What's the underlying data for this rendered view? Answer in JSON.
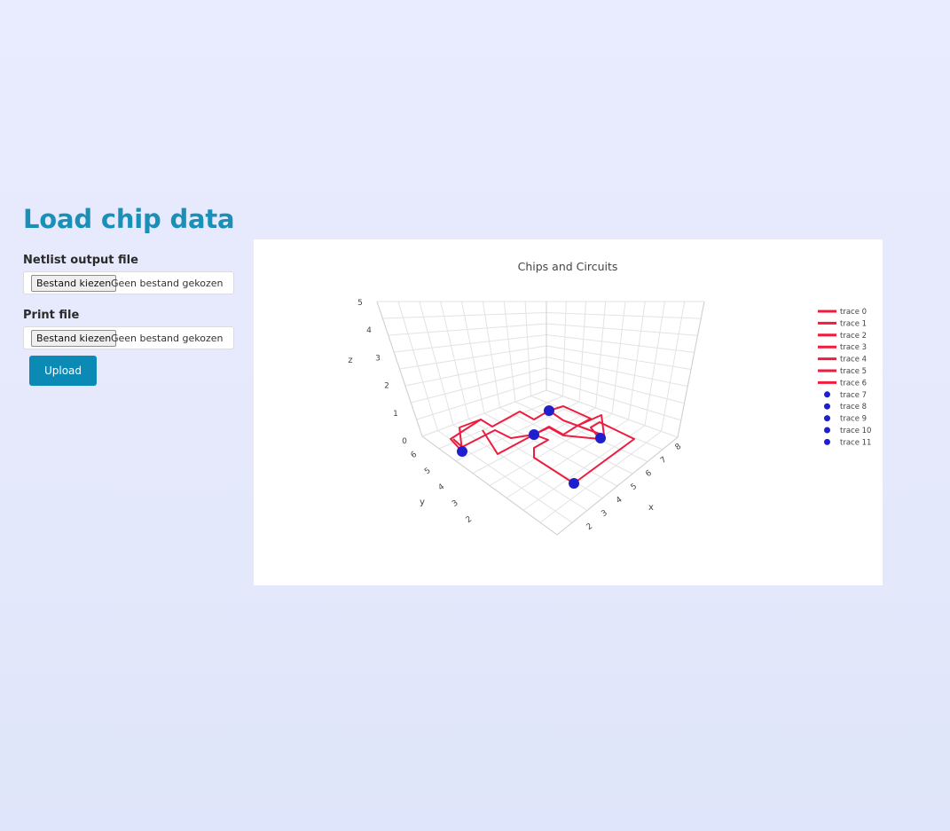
{
  "page": {
    "title": "Load chip data"
  },
  "form": {
    "netlist": {
      "label": "Netlist output file",
      "button_label": "Bestand kiezen",
      "status": "Geen bestand gekozen"
    },
    "print": {
      "label": "Print file",
      "button_label": "Bestand kiezen",
      "status": "Geen bestand gekozen"
    },
    "upload_label": "Upload"
  },
  "chart_data": {
    "type": "scatter3d",
    "title": "Chips and Circuits",
    "axes": {
      "x": {
        "label": "x",
        "ticks": [
          "2",
          "3",
          "4",
          "5",
          "6",
          "7",
          "8"
        ]
      },
      "y": {
        "label": "y",
        "ticks": [
          "2",
          "3",
          "4",
          "5",
          "6"
        ]
      },
      "z": {
        "label": "z",
        "ticks": [
          "0",
          "1",
          "2",
          "3",
          "4",
          "5"
        ]
      }
    },
    "grid": true,
    "legend_position": "right",
    "legend": [
      {
        "name": "trace 0",
        "kind": "line",
        "color": "#ee1c3f"
      },
      {
        "name": "trace 1",
        "kind": "line",
        "color": "#ee1c3f"
      },
      {
        "name": "trace 2",
        "kind": "line",
        "color": "#ee1c3f"
      },
      {
        "name": "trace 3",
        "kind": "line",
        "color": "#ee1c3f"
      },
      {
        "name": "trace 4",
        "kind": "line",
        "color": "#ee1c3f"
      },
      {
        "name": "trace 5",
        "kind": "line",
        "color": "#ee1c3f"
      },
      {
        "name": "trace 6",
        "kind": "line",
        "color": "#ee1c3f"
      },
      {
        "name": "trace 7",
        "kind": "marker",
        "color": "#1f1fcc"
      },
      {
        "name": "trace 8",
        "kind": "marker",
        "color": "#1f1fcc"
      },
      {
        "name": "trace 9",
        "kind": "marker",
        "color": "#1f1fcc"
      },
      {
        "name": "trace 10",
        "kind": "marker",
        "color": "#1f1fcc"
      },
      {
        "name": "trace 11",
        "kind": "marker",
        "color": "#1f1fcc"
      }
    ],
    "colors": {
      "wire": "#ee1c3f",
      "gate": "#1f1fcc"
    }
  }
}
